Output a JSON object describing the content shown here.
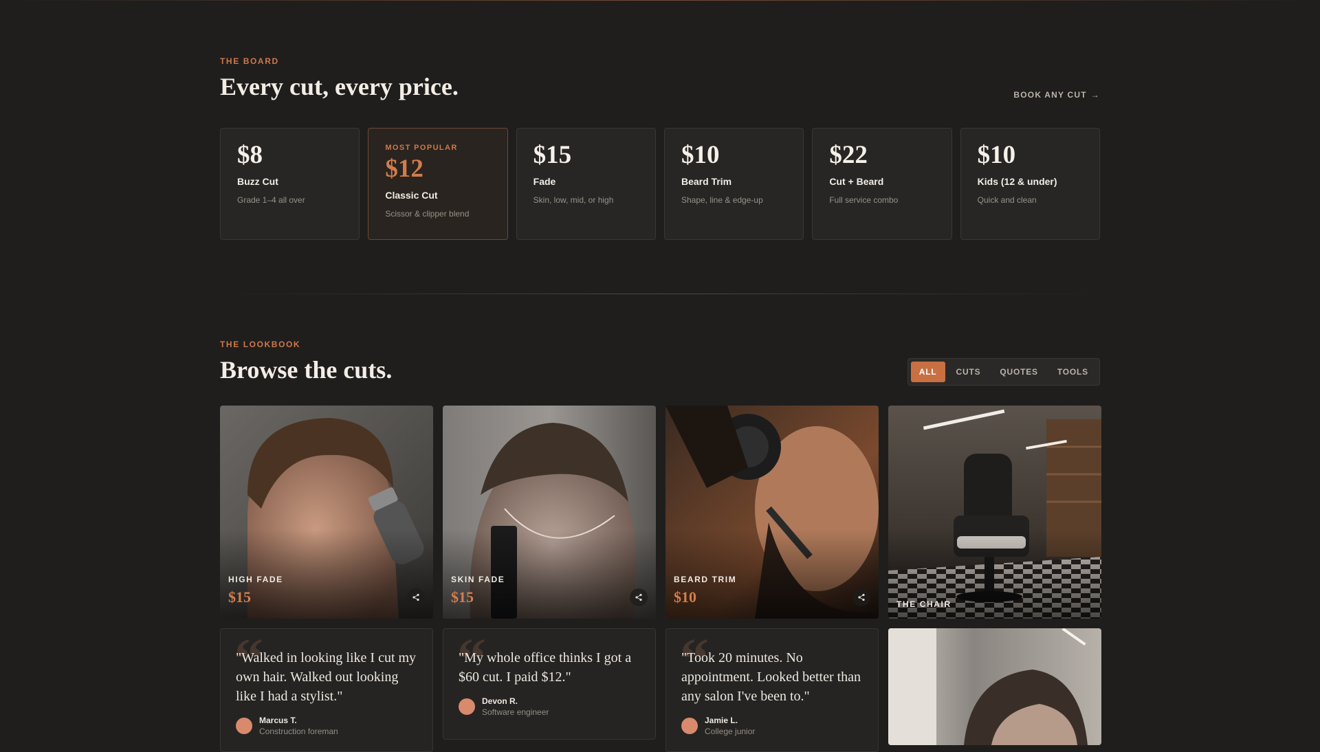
{
  "board": {
    "eyebrow": "THE BOARD",
    "title": "Every cut, every price.",
    "book_link": "BOOK ANY CUT",
    "cards": [
      {
        "price": "$8",
        "name": "Buzz Cut",
        "desc": "Grade 1–4 all over",
        "badge": ""
      },
      {
        "price": "$12",
        "name": "Classic Cut",
        "desc": "Scissor & clipper blend",
        "badge": "MOST POPULAR"
      },
      {
        "price": "$15",
        "name": "Fade",
        "desc": "Skin, low, mid, or high",
        "badge": ""
      },
      {
        "price": "$10",
        "name": "Beard Trim",
        "desc": "Shape, line & edge-up",
        "badge": ""
      },
      {
        "price": "$22",
        "name": "Cut + Beard",
        "desc": "Full service combo",
        "badge": ""
      },
      {
        "price": "$10",
        "name": "Kids (12 & under)",
        "desc": "Quick and clean",
        "badge": ""
      }
    ]
  },
  "lookbook": {
    "eyebrow": "THE LOOKBOOK",
    "title": "Browse the cuts.",
    "filters": [
      "ALL",
      "CUTS",
      "QUOTES",
      "TOOLS"
    ],
    "active_filter": "ALL",
    "tiles": [
      {
        "label": "HIGH FADE",
        "price": "$15"
      },
      {
        "label": "SKIN FADE",
        "price": "$15"
      },
      {
        "label": "BEARD TRIM",
        "price": "$10"
      },
      {
        "label": "THE CHAIR",
        "price": ""
      }
    ],
    "quotes": [
      {
        "text": "\"Walked in looking like I cut my own hair. Walked out looking like I had a stylist.\"",
        "name": "Marcus T.",
        "role": "Construction foreman"
      },
      {
        "text": "\"My whole office thinks I got a $60 cut. I paid $12.\"",
        "name": "Devon R.",
        "role": "Software engineer"
      },
      {
        "text": "\"Took 20 minutes. No appointment. Looked better than any salon I've been to.\"",
        "name": "Jamie L.",
        "role": "College junior"
      }
    ],
    "quote_mark": "“"
  },
  "colors": {
    "accent": "#c96f42",
    "background": "#1f1e1d",
    "card": "#272625"
  },
  "icons": {
    "share": "share-icon",
    "arrow": "arrow-right-icon"
  }
}
